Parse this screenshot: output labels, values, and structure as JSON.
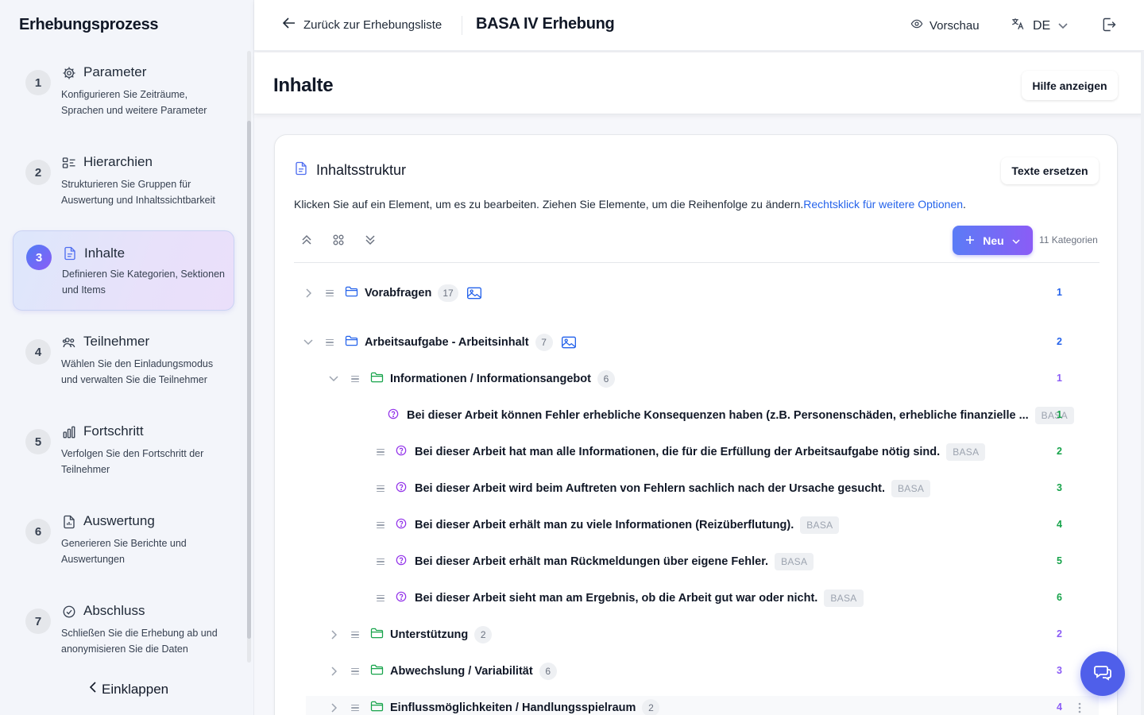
{
  "sidebar": {
    "title": "Erhebungsprozess",
    "collapse_label": "Einklappen",
    "steps": [
      {
        "num": "1",
        "title": "Parameter",
        "desc": "Konfigurieren Sie Zeiträume, Sprachen und weitere Parameter",
        "icon": "gear-icon"
      },
      {
        "num": "2",
        "title": "Hierarchien",
        "desc": "Strukturieren Sie Gruppen für Auswertung und Inhaltssichtbarkeit",
        "icon": "hierarchy-icon"
      },
      {
        "num": "3",
        "title": "Inhalte",
        "desc": "Definieren Sie Kategorien, Sektionen und Items",
        "icon": "document-icon",
        "active": true
      },
      {
        "num": "4",
        "title": "Teilnehmer",
        "desc": "Wählen Sie den Einladungsmodus und verwalten Sie die Teilnehmer",
        "icon": "users-icon"
      },
      {
        "num": "5",
        "title": "Fortschritt",
        "desc": "Verfolgen Sie den Fortschritt der Teilnehmer",
        "icon": "bar-chart-icon"
      },
      {
        "num": "6",
        "title": "Auswertung",
        "desc": "Generieren Sie Berichte und Auswertungen",
        "icon": "report-icon"
      },
      {
        "num": "7",
        "title": "Abschluss",
        "desc": "Schließen Sie die Erhebung ab und anonymisieren Sie die Daten",
        "icon": "check-circle-icon"
      }
    ]
  },
  "header": {
    "back_label": "Zurück zur Erhebungsliste",
    "survey_title": "BASA IV Erhebung",
    "preview_label": "Vorschau",
    "language": "DE"
  },
  "page": {
    "title": "Inhalte",
    "help_button": "Hilfe anzeigen"
  },
  "card": {
    "title": "Inhaltsstruktur",
    "replace_button": "Texte ersetzen",
    "hint_text": "Klicken Sie auf ein Element, um es zu bearbeiten. Ziehen Sie Elemente, um die Reihenfolge zu ändern.",
    "hint_link": "Rechtsklick für weitere Optionen",
    "hint_suffix": ".",
    "new_button": "Neu",
    "category_count": "11 Kategorien"
  },
  "tree": {
    "categories": [
      {
        "label": "Vorabfragen",
        "count": "17",
        "order": "1"
      },
      {
        "label": "Arbeitsaufgabe - Arbeitsinhalt",
        "count": "7",
        "order": "2"
      }
    ],
    "sections": [
      {
        "label": "Informationen / Informationsangebot",
        "count": "6",
        "order": "1"
      },
      {
        "label": "Unterstützung",
        "count": "2",
        "order": "2"
      },
      {
        "label": "Abwechslung / Variabilität",
        "count": "6",
        "order": "3"
      },
      {
        "label": "Einflussmöglichkeiten / Handlungsspielraum",
        "count": "2",
        "order": "4"
      }
    ],
    "items": [
      {
        "label": "Bei dieser Arbeit können Fehler erhebliche Konsequenzen haben (z.B. Personenschäden, erhebliche finanzielle ...",
        "tag": "BASA",
        "order": "1"
      },
      {
        "label": "Bei dieser Arbeit hat man alle Informationen, die für die Erfüllung der Arbeitsaufgabe nötig sind.",
        "tag": "BASA",
        "order": "2"
      },
      {
        "label": "Bei dieser Arbeit wird beim Auftreten von Fehlern sachlich nach der Ursache gesucht.",
        "tag": "BASA",
        "order": "3"
      },
      {
        "label": "Bei dieser Arbeit erhält man zu viele Informationen (Reizüberflutung).",
        "tag": "BASA",
        "order": "4"
      },
      {
        "label": "Bei dieser Arbeit erhält man Rückmeldungen über eigene Fehler.",
        "tag": "BASA",
        "order": "5"
      },
      {
        "label": "Bei dieser Arbeit sieht man am Ergebnis, ob die Arbeit gut war oder nicht.",
        "tag": "BASA",
        "order": "6"
      }
    ]
  },
  "colors": {
    "accent_blue": "#2563eb",
    "accent_purple": "#8b5cf6",
    "order_green": "#16a34a",
    "section_folder_green": "#16a34a",
    "category_folder_blue": "#2563eb"
  }
}
